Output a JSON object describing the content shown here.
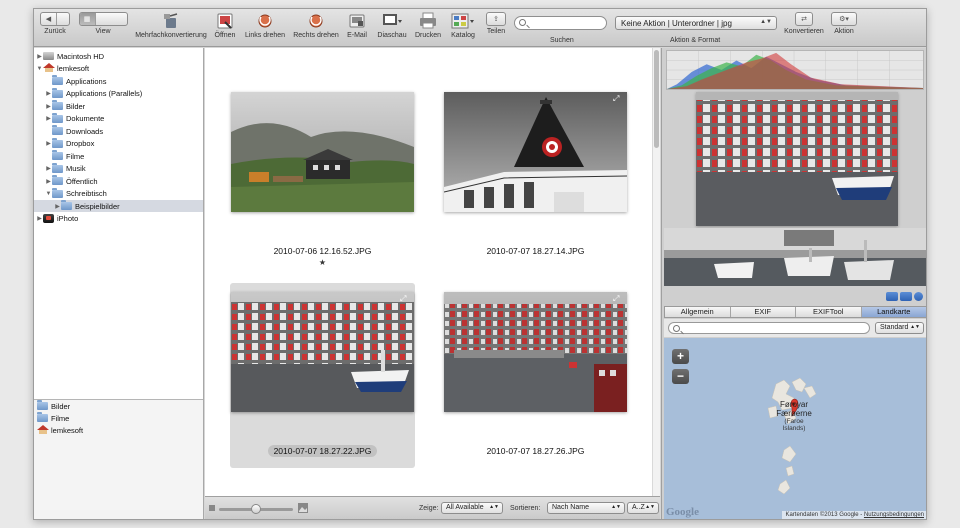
{
  "toolbar": {
    "back_label": "Zurück",
    "view_label": "View",
    "batch_label": "Mehrfachkonvertierung",
    "open_label": "Öffnen",
    "rotate_left_label": "Links drehen",
    "rotate_right_label": "Rechts drehen",
    "email_label": "E-Mail",
    "slideshow_label": "Diaschau",
    "print_label": "Drucken",
    "catalog_label": "Katalog",
    "share_label": "Teilen",
    "search_label": "Suchen",
    "action_select_value": "Keine Aktion | Unterordner | jpg",
    "action_format_label": "Aktion & Format",
    "convert_label": "Konvertieren",
    "action_label": "Aktion"
  },
  "sidebar": {
    "tree": [
      {
        "label": "Macintosh HD",
        "icon": "hd",
        "level": 0,
        "tri": "▶"
      },
      {
        "label": "lemkesoft",
        "icon": "home",
        "level": 0,
        "tri": "▼"
      },
      {
        "label": "Applications",
        "icon": "folder",
        "level": 1,
        "tri": ""
      },
      {
        "label": "Applications (Parallels)",
        "icon": "folder",
        "level": 1,
        "tri": "▶"
      },
      {
        "label": "Bilder",
        "icon": "folder",
        "level": 1,
        "tri": "▶"
      },
      {
        "label": "Dokumente",
        "icon": "folder",
        "level": 1,
        "tri": "▶"
      },
      {
        "label": "Downloads",
        "icon": "folder",
        "level": 1,
        "tri": ""
      },
      {
        "label": "Dropbox",
        "icon": "folder",
        "level": 1,
        "tri": "▶"
      },
      {
        "label": "Filme",
        "icon": "folder",
        "level": 1,
        "tri": ""
      },
      {
        "label": "Musik",
        "icon": "folder",
        "level": 1,
        "tri": "▶"
      },
      {
        "label": "Öffentlich",
        "icon": "folder",
        "level": 1,
        "tri": "▶"
      },
      {
        "label": "Schreibtisch",
        "icon": "folder",
        "level": 1,
        "tri": "▼"
      },
      {
        "label": "Beispielbilder",
        "icon": "folder",
        "level": 2,
        "tri": "▶",
        "selected": true
      },
      {
        "label": "iPhoto",
        "icon": "iphoto",
        "level": 0,
        "tri": "▶"
      }
    ],
    "favorites": [
      "Bilder",
      "Filme",
      "lemkesoft"
    ]
  },
  "grid": {
    "items": [
      {
        "filename": "2010-07-06 12.16.52.JPG",
        "rating": "★",
        "selected": false
      },
      {
        "filename": "2010-07-07 18.27.14.JPG",
        "rating": "",
        "selected": false
      },
      {
        "filename": "2010-07-07 18.27.22.JPG",
        "rating": "",
        "selected": true
      },
      {
        "filename": "2010-07-07 18.27.26.JPG",
        "rating": "",
        "selected": false
      }
    ]
  },
  "bottombar": {
    "show_label": "Zeige:",
    "show_value": "All Available",
    "sort_label": "Sortieren:",
    "sort_value": "Nach Name",
    "order_value": "A..Z",
    "thumb_size": 0.5
  },
  "inspector": {
    "tabs": [
      "Allgemein",
      "EXIF",
      "EXIFTool",
      "Landkarte"
    ],
    "active_tab": 3,
    "map_type": "Standard",
    "map_label_1": "Føroyar",
    "map_label_2": "Færøerne",
    "map_label_3": "(Faroe",
    "map_label_4": "Islands)",
    "google": "Google",
    "credit": "Kartendaten ©2013 Google -",
    "terms": "Nutzungsbedingungen",
    "zoom_in": "+",
    "zoom_out": "−"
  },
  "colors": {
    "accent": "#8aa6d3",
    "selection": "#d5d9e1"
  }
}
